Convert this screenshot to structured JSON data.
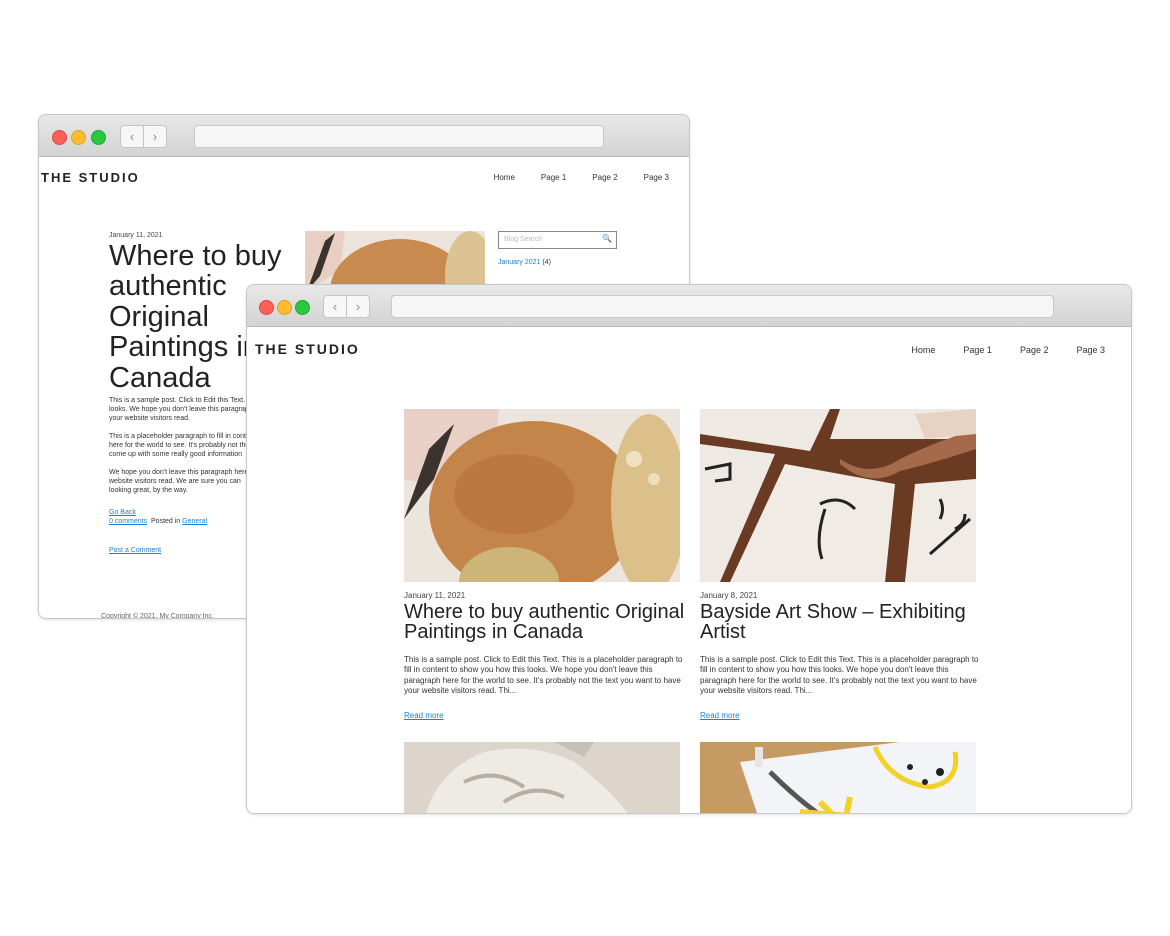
{
  "back_window": {
    "logo": "THE STUDIO",
    "nav": [
      "Home",
      "Page 1",
      "Page 2",
      "Page 3"
    ],
    "post": {
      "date": "January 11, 2021",
      "title": "Where to buy\nauthentic\nOriginal\nPaintings in\nCanada",
      "paragraphs": [
        [
          "This is a sample post. Click to Edit this Text.",
          "looks.  We hope you don't leave this paragraph",
          "your website visitors read."
        ],
        [
          "This is a placeholder paragraph to fill in content",
          "here for the world to see.  It's probably not the",
          "come up with some really good information"
        ],
        [
          "We hope you don't leave this paragraph here",
          "website visitors read.  We are sure you can",
          "looking great, by the way."
        ]
      ],
      "go_back": "Go Back",
      "comments_link": "0 comments",
      "posted_in": "Posted in",
      "category": "General",
      "post_comment": "Post a Comment",
      "footer": "Copyright © 2021. My Company Inc."
    },
    "sidebar": {
      "search_placeholder": "Blog Search",
      "archive_link": "January 2021",
      "archive_count": "(4)"
    }
  },
  "front_window": {
    "logo": "THE STUDIO",
    "nav": [
      "Home",
      "Page 1",
      "Page 2",
      "Page 3"
    ],
    "posts": [
      {
        "image": "abstract-watercolor-shapes",
        "date": "January 11, 2021",
        "title": "Where to buy authentic Original Paintings in Canada",
        "excerpt": "This is a sample post. Click to Edit this Text.  This is a placeholder paragraph to fill in content to show you how this looks.  We hope you don't leave this paragraph here for the world to see.  It's probably not the text you want to have your website visitors read. Thi...",
        "read_more": "Read more"
      },
      {
        "image": "artist-painting-faces-on-floor",
        "date": "January 8, 2021",
        "title": "Bayside Art Show – Exhibiting Artist",
        "excerpt": "This is a sample post. Click to Edit this Text.  This is a placeholder paragraph to fill in content to show you how this looks.  We hope you don't leave this paragraph here for the world to see.  It's probably not the text you want to have your website visitors read. Thi...",
        "read_more": "Read more"
      },
      {
        "image": "marble-statue-drapery"
      },
      {
        "image": "yellow-paint-on-paper"
      }
    ]
  },
  "colors": {
    "link": "#1a82d6",
    "close": "#fe5f57",
    "minimize": "#febc2e",
    "zoom": "#28c840"
  }
}
